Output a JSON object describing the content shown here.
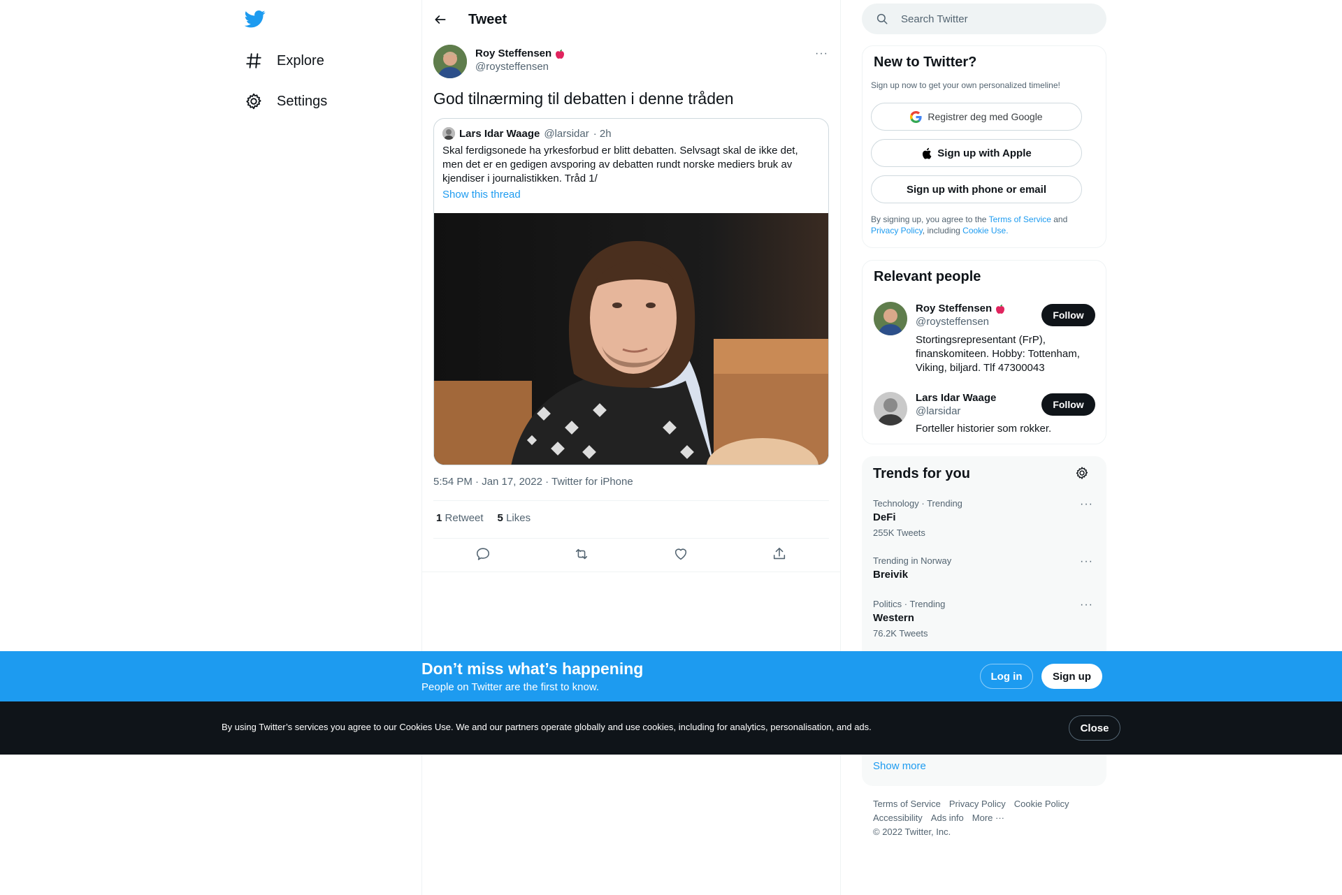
{
  "nav": {
    "logo": "twitter-bird-icon",
    "items": [
      {
        "label": "Explore",
        "icon": "hashtag-icon"
      },
      {
        "label": "Settings",
        "icon": "gear-icon"
      }
    ]
  },
  "header": {
    "title": "Tweet",
    "back_icon": "arrow-left-icon"
  },
  "tweet": {
    "author": {
      "name": "Roy Steffensen",
      "handle": "@roysteffensen",
      "badge": "apple-icon"
    },
    "text": "God tilnærming til debatten i denne tråden",
    "quote": {
      "author_name": "Lars Idar Waage",
      "author_handle": "@larsidar",
      "time": "· 2h",
      "text": "Skal ferdigsonede ha yrkesforbud er blitt debatten. Selvsagt skal de ikke det, men det er en gedigen avsporing av debatten rundt norske mediers bruk av kjendiser i journalistikken. Tråd 1/",
      "show_thread": "Show this thread"
    },
    "meta": "5:54 PM · Jan 17, 2022 · Twitter for iPhone",
    "retweets_count": "1",
    "retweets_label": "Retweet",
    "likes_count": "5",
    "likes_label": "Likes"
  },
  "search": {
    "placeholder": "Search Twitter"
  },
  "new_to_twitter": {
    "title": "New to Twitter?",
    "subtitle": "Sign up now to get your own personalized timeline!",
    "google_btn": "Registrer deg med Google",
    "apple_btn": "Sign up with Apple",
    "phone_btn": "Sign up with phone or email",
    "legal_prefix": "By signing up, you agree to the ",
    "terms": "Terms of Service",
    "and": " and",
    "privacy": "Privacy Policy",
    "including": ", including ",
    "cookie": "Cookie Use."
  },
  "relevant": {
    "title": "Relevant people",
    "people": [
      {
        "name": "Roy Steffensen",
        "handle": "@roysteffensen",
        "bio": "Stortingsrepresentant (FrP), finanskomiteen. Hobby: Tottenham, Viking, biljard. Tlf 47300043",
        "follow": "Follow"
      },
      {
        "name": "Lars Idar Waage",
        "handle": "@larsidar",
        "bio": "Forteller historier som rokker.",
        "follow": "Follow"
      }
    ]
  },
  "trends": {
    "title": "Trends for you",
    "items": [
      {
        "meta": "Technology · Trending",
        "name": "DeFi",
        "count": "255K Tweets"
      },
      {
        "meta": "Trending in Norway",
        "name": "Breivik",
        "count": ""
      },
      {
        "meta": "Politics · Trending",
        "name": "Western",
        "count": "76.2K Tweets"
      }
    ],
    "show_more": "Show more"
  },
  "footer": {
    "links1": [
      "Terms of Service",
      "Privacy Policy",
      "Cookie Policy"
    ],
    "links2": [
      "Accessibility",
      "Ads info",
      "More ···"
    ],
    "copyright": "© 2022 Twitter, Inc."
  },
  "banner": {
    "title": "Don’t miss what’s happening",
    "subtitle": "People on Twitter are the first to know.",
    "login": "Log in",
    "signup": "Sign up"
  },
  "cookie": {
    "text": "By using Twitter’s services you agree to our Cookies Use. We and our partners operate globally and use cookies, including for analytics, personalisation, and ads.",
    "close": "Close"
  },
  "colors": {
    "accent": "#1d9bf0",
    "dark": "#0f1419",
    "muted": "#536471"
  }
}
